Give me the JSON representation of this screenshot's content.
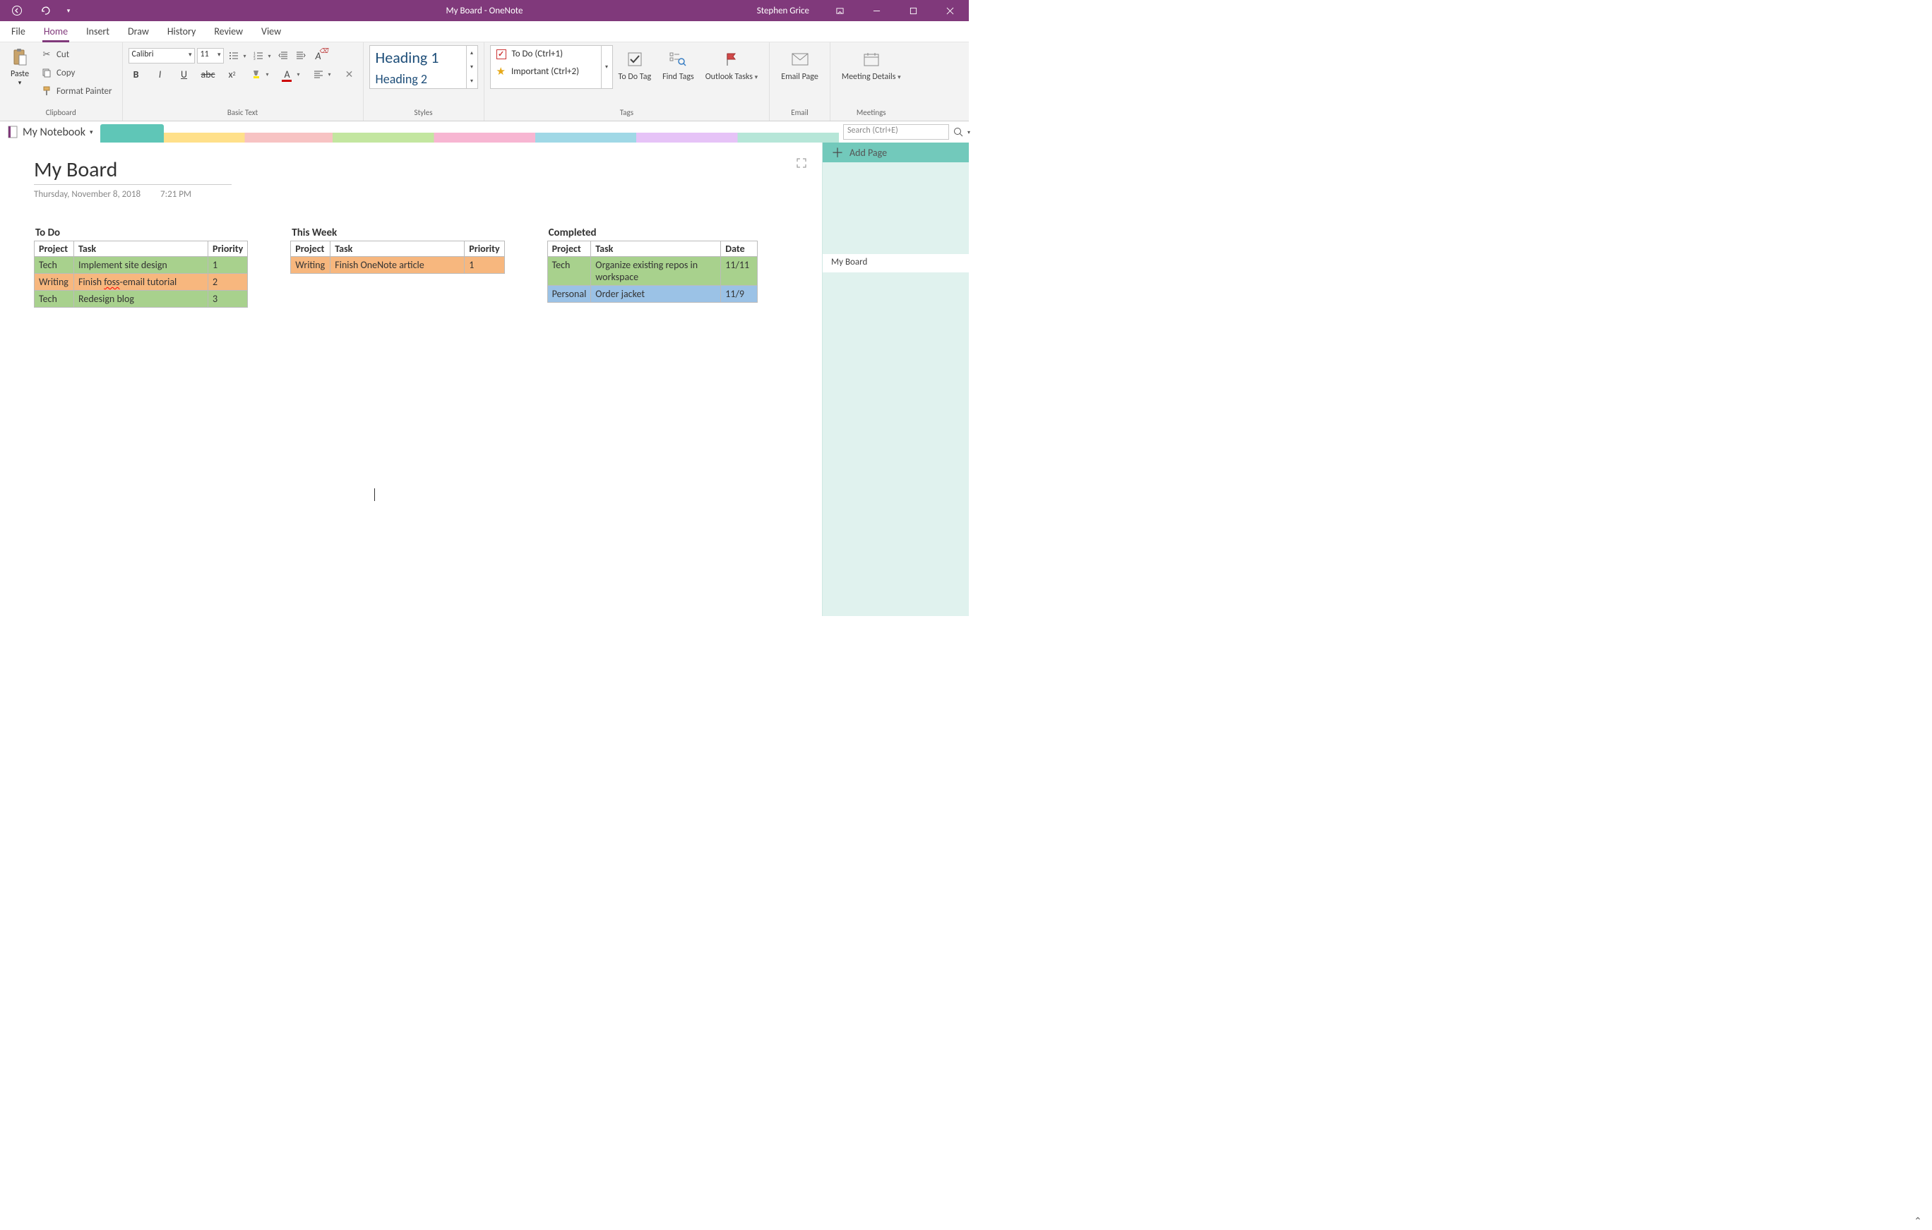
{
  "title_bar": {
    "app_title": "My Board  -  OneNote"
  },
  "user": "Stephen Grice",
  "ribbon": {
    "tabs": [
      "File",
      "Home",
      "Insert",
      "Draw",
      "History",
      "Review",
      "View"
    ],
    "active": 1,
    "clipboard": {
      "paste": "Paste",
      "cut": "Cut",
      "copy": "Copy",
      "format_painter": "Format Painter",
      "group": "Clipboard"
    },
    "basic_text": {
      "font": "Calibri",
      "size": "11",
      "group": "Basic Text"
    },
    "styles": {
      "h1": "Heading 1",
      "h2": "Heading 2",
      "group": "Styles"
    },
    "tags": {
      "todo": "To Do (Ctrl+1)",
      "important": "Important (Ctrl+2)",
      "todo_tag": "To Do Tag",
      "find_tags": "Find Tags",
      "outlook_tasks": "Outlook Tasks",
      "group": "Tags"
    },
    "email": {
      "email_page": "Email Page",
      "group": "Email"
    },
    "meetings": {
      "meeting_details": "Meeting Details",
      "group": "Meetings"
    }
  },
  "notebook": {
    "name": "My Notebook"
  },
  "search": {
    "placeholder": "Search (Ctrl+E)"
  },
  "sidebar": {
    "add_page": "Add Page",
    "pages": [
      "My Board"
    ]
  },
  "page": {
    "title": "My Board",
    "date": "Thursday, November 8, 2018",
    "time": "7:21 PM"
  },
  "boards": [
    {
      "title": "To Do",
      "headers": [
        "Project",
        "Task",
        "Priority"
      ],
      "col_keys": [
        "project",
        "task",
        "priority"
      ],
      "rows": [
        {
          "project": "Tech",
          "task": "Implement site design",
          "priority": "1",
          "color": "green"
        },
        {
          "project": "Writing",
          "task": "Finish foss-email tutorial",
          "priority": "2",
          "color": "orange",
          "squiggle_word": "foss"
        },
        {
          "project": "Tech",
          "task": "Redesign blog",
          "priority": "3",
          "color": "green"
        }
      ]
    },
    {
      "title": "This Week",
      "headers": [
        "Project",
        "Task",
        "Priority"
      ],
      "col_keys": [
        "project",
        "task",
        "priority"
      ],
      "rows": [
        {
          "project": "Writing",
          "task": "Finish OneNote article",
          "priority": "1",
          "color": "orange"
        }
      ]
    },
    {
      "title": "Completed",
      "headers": [
        "Project",
        "Task",
        "Date"
      ],
      "col_keys": [
        "project",
        "task",
        "date"
      ],
      "rows": [
        {
          "project": "Tech",
          "task": "Organize existing repos in workspace",
          "date": "11/11",
          "color": "green"
        },
        {
          "project": "Personal",
          "task": "Order jacket",
          "date": "11/9",
          "color": "blue"
        }
      ]
    }
  ]
}
